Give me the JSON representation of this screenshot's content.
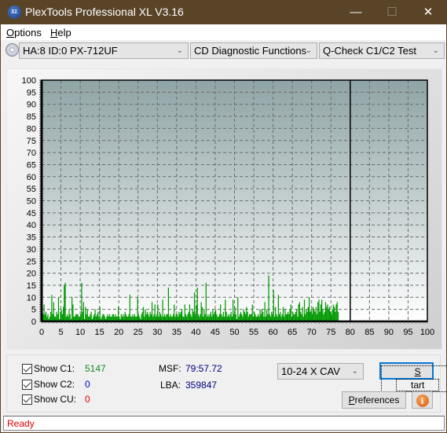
{
  "window": {
    "title": "PlexTools Professional XL V3.16",
    "app_icon_text": "XL",
    "controls": {
      "minimize": "—",
      "maximize": "☐",
      "close": "✕"
    }
  },
  "menu": {
    "items": [
      {
        "label": "Options",
        "accel": "O",
        "rest": "ptions"
      },
      {
        "label": "Help",
        "accel": "H",
        "rest": "elp"
      }
    ]
  },
  "toolbar": {
    "drive_select": "HA:8 ID:0  PX-712UF",
    "function_select": "CD Diagnostic Functions",
    "test_select": "Q-Check C1/C2 Test"
  },
  "colors": {
    "c1": "#009900",
    "c2": "#0000cc",
    "cu": "#e00000",
    "status": "#e00000",
    "msf_lba": "#00007f",
    "titlebar": "#5a4428"
  },
  "chart_data": {
    "type": "bar",
    "title": "",
    "xlabel": "",
    "ylabel": "",
    "xlim": [
      0,
      100
    ],
    "ylim": [
      0,
      100
    ],
    "x_ticks": [
      0,
      5,
      10,
      15,
      20,
      25,
      30,
      35,
      40,
      45,
      50,
      55,
      60,
      65,
      70,
      75,
      80,
      85,
      90,
      95,
      100
    ],
    "y_ticks": [
      0,
      5,
      10,
      15,
      20,
      25,
      30,
      35,
      40,
      45,
      50,
      55,
      60,
      65,
      70,
      75,
      80,
      85,
      90,
      95,
      100
    ],
    "grid": true,
    "end_marker_x": 80,
    "series": [
      {
        "name": "C1",
        "x_step": 0.25,
        "x_start": 0,
        "values": [
          5,
          3,
          7,
          3,
          4,
          2,
          3,
          1,
          2,
          4,
          11,
          3,
          8,
          2,
          2,
          4,
          3,
          10,
          1,
          4,
          5,
          3,
          6,
          15,
          16,
          2,
          3,
          2,
          5,
          3,
          1,
          10,
          7,
          2,
          2,
          3,
          3,
          3,
          2,
          2,
          3,
          16,
          4,
          8,
          1,
          6,
          3,
          5,
          2,
          2,
          3,
          4,
          1,
          2,
          3,
          5,
          2,
          3,
          4,
          2,
          6,
          1,
          2,
          3,
          3,
          2,
          1,
          2,
          3,
          2,
          3,
          2,
          2,
          3,
          3,
          2,
          3,
          2,
          2,
          6,
          2,
          1,
          3,
          2,
          3,
          2,
          4,
          3,
          2,
          2,
          3,
          11,
          2,
          2,
          3,
          2,
          3,
          2,
          2,
          10,
          3,
          2,
          1,
          3,
          4,
          6,
          2,
          5,
          3,
          4,
          3,
          2,
          4,
          3,
          8,
          2,
          3,
          7,
          2,
          3,
          7,
          2,
          4,
          3,
          2,
          9,
          2,
          3,
          2,
          3,
          3,
          14,
          2,
          3,
          2,
          2,
          3,
          7,
          2,
          3,
          3,
          2,
          4,
          3,
          4,
          5,
          2,
          2,
          7,
          3,
          2,
          3,
          4,
          7,
          3,
          2,
          5,
          4,
          12,
          3,
          7,
          14,
          3,
          2,
          3,
          8,
          6,
          2,
          5,
          3,
          16,
          2,
          3,
          2,
          3,
          4,
          2,
          5,
          3,
          4,
          5,
          3,
          2,
          2,
          3,
          7,
          3,
          2,
          4,
          2,
          9,
          4,
          2,
          3,
          2,
          3,
          4,
          2,
          9,
          3,
          6,
          3,
          1,
          10,
          2,
          3,
          4,
          3,
          2,
          5,
          4,
          3,
          6,
          4,
          2,
          3,
          3,
          3,
          7,
          2,
          4,
          3,
          2,
          2,
          3,
          2,
          5,
          3,
          5,
          4,
          2,
          8,
          2,
          5,
          3,
          19,
          3,
          2,
          4,
          3,
          13,
          2,
          6,
          3,
          2,
          11,
          3,
          4,
          2,
          3,
          6,
          2,
          5,
          3,
          3,
          4,
          3,
          5,
          7,
          2,
          4,
          3,
          3,
          4,
          5,
          2,
          7,
          8,
          4,
          3,
          6,
          2,
          9,
          3,
          5,
          4,
          6,
          10,
          4,
          5,
          3,
          6,
          5,
          4,
          6,
          3,
          8,
          9,
          4,
          7,
          9,
          5,
          3,
          4,
          8,
          6,
          7,
          5,
          6,
          4,
          3,
          5,
          7,
          6,
          4,
          7,
          8,
          4
        ],
        "color": "#009900"
      }
    ]
  },
  "stats": {
    "show_c1_label": "Show C1:",
    "show_c2_label": "Show C2:",
    "show_cu_label": "Show CU:",
    "c1_checked": true,
    "c2_checked": true,
    "cu_checked": true,
    "c1_value": "5147",
    "c2_value": "0",
    "cu_value": "0",
    "msf_label": "MSF:",
    "msf_value": "79:57.72",
    "lba_label": "LBA:",
    "lba_value": "359847"
  },
  "controls": {
    "speed_select": "10-24 X CAV",
    "start_accel": "S",
    "start_rest": "tart",
    "preferences_accel": "P",
    "preferences_rest": "references",
    "info_glyph": "i"
  },
  "status": {
    "text": "Ready"
  }
}
